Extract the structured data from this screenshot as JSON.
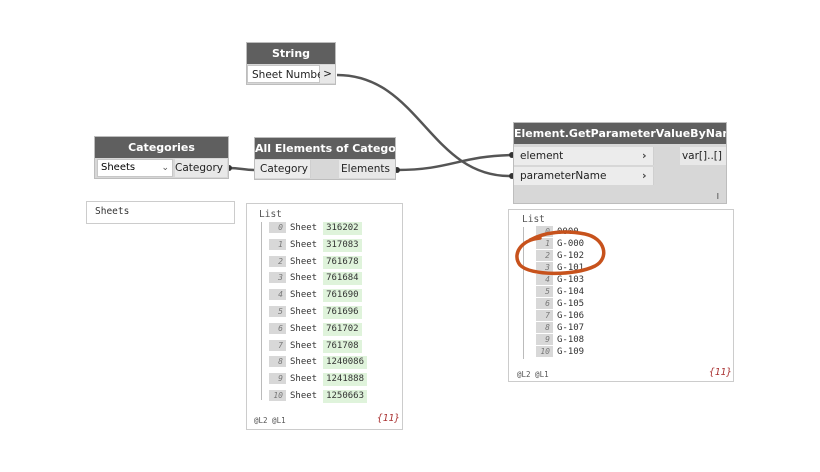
{
  "nodes": {
    "string": {
      "title": "String",
      "input_value": "Sheet Number",
      "output_symbol": ">"
    },
    "categories": {
      "title": "Categories",
      "selected": "Sheets",
      "output_label": "Category",
      "preview_value": "Sheets"
    },
    "all_elements": {
      "title": "All Elements of Category",
      "input_label": "Category",
      "output_label": "Elements",
      "preview": {
        "header": "List",
        "rows": [
          {
            "index": "0",
            "type": "Sheet",
            "id": "316202"
          },
          {
            "index": "1",
            "type": "Sheet",
            "id": "317083"
          },
          {
            "index": "2",
            "type": "Sheet",
            "id": "761678"
          },
          {
            "index": "3",
            "type": "Sheet",
            "id": "761684"
          },
          {
            "index": "4",
            "type": "Sheet",
            "id": "761690"
          },
          {
            "index": "5",
            "type": "Sheet",
            "id": "761696"
          },
          {
            "index": "6",
            "type": "Sheet",
            "id": "761702"
          },
          {
            "index": "7",
            "type": "Sheet",
            "id": "761708"
          },
          {
            "index": "8",
            "type": "Sheet",
            "id": "1240086"
          },
          {
            "index": "9",
            "type": "Sheet",
            "id": "1241888"
          },
          {
            "index": "10",
            "type": "Sheet",
            "id": "1250663"
          }
        ],
        "levels": "@L2 @L1",
        "count": "{11}"
      }
    },
    "getparam": {
      "title": "Element.GetParameterValueByName",
      "input1_label": "element",
      "input2_label": "parameterName",
      "output_label": "var[]..[]",
      "lacing": "l",
      "preview": {
        "header": "List",
        "rows": [
          {
            "index": "0",
            "value": "0000"
          },
          {
            "index": "1",
            "value": "G-000"
          },
          {
            "index": "2",
            "value": "G-102"
          },
          {
            "index": "3",
            "value": "G-101"
          },
          {
            "index": "4",
            "value": "G-103"
          },
          {
            "index": "5",
            "value": "G-104"
          },
          {
            "index": "6",
            "value": "G-105"
          },
          {
            "index": "7",
            "value": "G-106"
          },
          {
            "index": "8",
            "value": "G-107"
          },
          {
            "index": "9",
            "value": "G-108"
          },
          {
            "index": "10",
            "value": "G-109"
          }
        ],
        "levels": "@L2 @L1",
        "count": "{11}"
      }
    }
  },
  "colors": {
    "title_bar": "#5f5f5f",
    "wire": "#555555",
    "highlight_circle": "#c7521c",
    "id_highlight": "#dff3db"
  },
  "icons": {
    "chevron": "chevron-right-icon",
    "dropdown": "chevron-down-icon"
  }
}
